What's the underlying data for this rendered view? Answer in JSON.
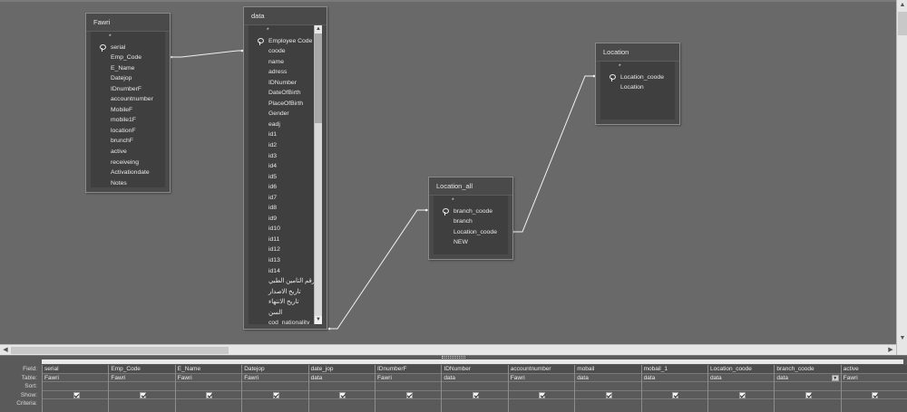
{
  "tables": {
    "fawri": {
      "title": "Fawri",
      "fields": [
        "*",
        "serial",
        "Emp_Code",
        "E_Name",
        "Datejop",
        "IDnumberF",
        "accountnumber",
        "MobileF",
        "mobile1F",
        "locationF",
        "brunchF",
        "active",
        "receiveing",
        "Activationdate",
        "Notes"
      ]
    },
    "data": {
      "title": "data",
      "fields": [
        "*",
        "Employee Code",
        "coode",
        "name",
        "adress",
        "IDNumber",
        "DateOfBirth",
        "PlaceOfBirth",
        "Gender",
        "eadj",
        "id1",
        "id2",
        "id3",
        "id4",
        "id5",
        "id6",
        "id7",
        "id8",
        "id9",
        "id10",
        "id11",
        "id12",
        "id13",
        "id14",
        "رقم التامين الطبي",
        "تاريخ الاصدار",
        "تاريخ الانتهاء",
        "السن",
        "cod_nationality"
      ]
    },
    "location": {
      "title": "Location",
      "fields": [
        "*",
        "Location_coode",
        "Location"
      ]
    },
    "location_all": {
      "title": "Location_all",
      "fields": [
        "*",
        "branch_coode",
        "branch",
        "Location_coode",
        "NEW"
      ]
    }
  },
  "scrollbar": {
    "up_arrow": "▲",
    "down_arrow": "▼",
    "left_arrow": "◀",
    "right_arrow": "▶"
  },
  "grid": {
    "row_labels": [
      "Field:",
      "Table:",
      "Sort:",
      "Show:",
      "Criteria:"
    ],
    "columns": [
      {
        "field": "serial",
        "table": "Fawri",
        "show": true
      },
      {
        "field": "Emp_Code",
        "table": "Fawri",
        "show": true
      },
      {
        "field": "E_Name",
        "table": "Fawri",
        "show": true
      },
      {
        "field": "Datejop",
        "table": "Fawri",
        "show": true
      },
      {
        "field": "date_jop",
        "table": "data",
        "show": true
      },
      {
        "field": "IDnumberF",
        "table": "Fawri",
        "show": true
      },
      {
        "field": "IDNumber",
        "table": "data",
        "show": true
      },
      {
        "field": "accountnumber",
        "table": "Fawri",
        "show": true
      },
      {
        "field": "mobail",
        "table": "data",
        "show": true
      },
      {
        "field": "mobail_1",
        "table": "data",
        "show": true
      },
      {
        "field": "Location_coode",
        "table": "data",
        "show": true
      },
      {
        "field": "branch_coode",
        "table": "data",
        "show": true
      },
      {
        "field": "active",
        "table": "Fawri",
        "show": true
      }
    ]
  }
}
